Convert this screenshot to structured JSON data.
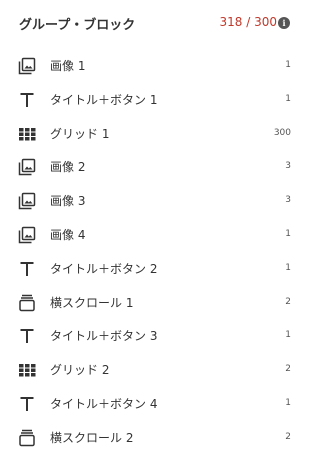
{
  "header": {
    "title": "グループ・ブロック",
    "count": "318 / 300",
    "info_icon": "i"
  },
  "items": [
    {
      "label": "画像 1",
      "count": "1",
      "icon": "image-icon"
    },
    {
      "label": "タイトル＋ボタン 1",
      "count": "1",
      "icon": "text-icon"
    },
    {
      "label": "グリッド 1",
      "count": "300",
      "icon": "grid-icon"
    },
    {
      "label": "画像 2",
      "count": "3",
      "icon": "image-icon"
    },
    {
      "label": "画像 3",
      "count": "3",
      "icon": "image-icon"
    },
    {
      "label": "画像 4",
      "count": "1",
      "icon": "image-icon"
    },
    {
      "label": "タイトル＋ボタン 2",
      "count": "1",
      "icon": "text-icon"
    },
    {
      "label": "横スクロール 1",
      "count": "2",
      "icon": "horizontal-scroll-icon"
    },
    {
      "label": "タイトル＋ボタン 3",
      "count": "1",
      "icon": "text-icon"
    },
    {
      "label": "グリッド 2",
      "count": "2",
      "icon": "grid-icon"
    },
    {
      "label": "タイトル＋ボタン 4",
      "count": "1",
      "icon": "text-icon"
    },
    {
      "label": "横スクロール 2",
      "count": "2",
      "icon": "horizontal-scroll-icon"
    }
  ],
  "colors": {
    "count_over_limit": "#c0392b",
    "icon": "#333333"
  }
}
